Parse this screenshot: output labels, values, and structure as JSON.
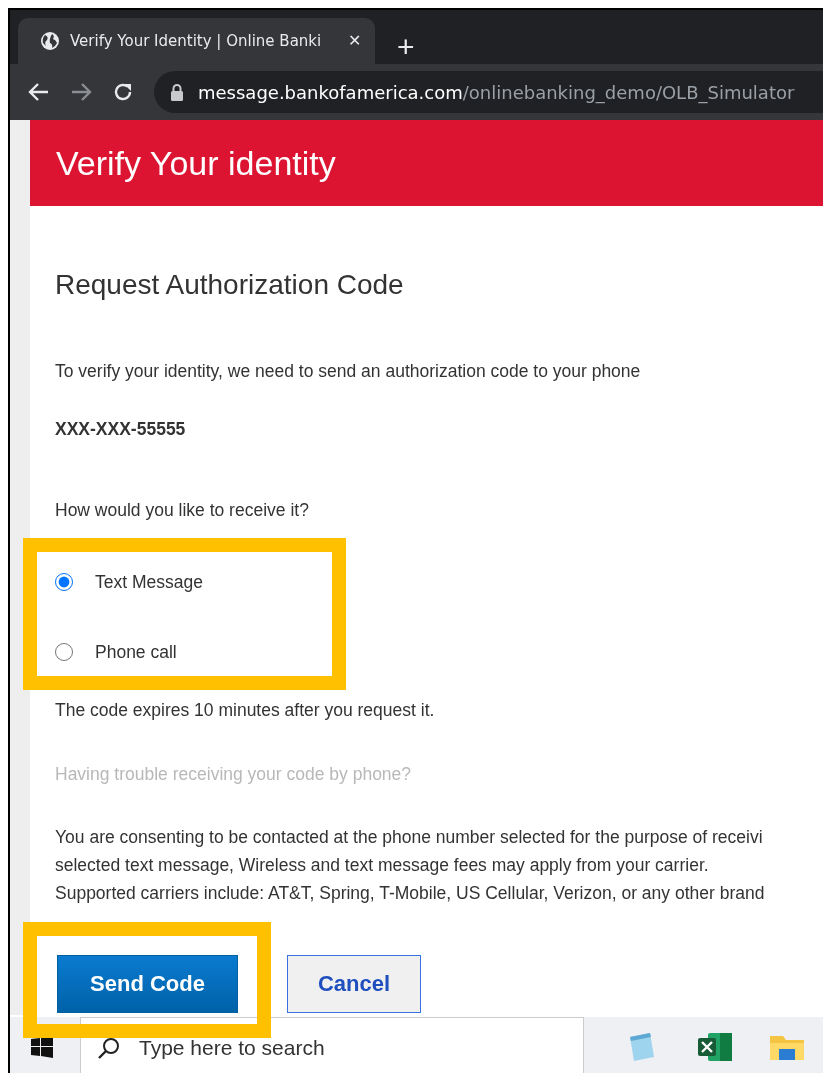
{
  "browser": {
    "tab_title": "Verify Your Identity | Online Banki",
    "close_glyph": "✕",
    "new_tab_glyph": "+",
    "url_host": "message.bankofamerica.com",
    "url_path": "/onlinebanking_demo/OLB_Simulator"
  },
  "header": {
    "title": "Verify Your identity"
  },
  "page": {
    "heading": "Request Authorization Code",
    "intro": "To verify your identity, we need to send an authorization code to your phone",
    "phone": "XXX-XXX-55555",
    "question": "How would you like to receive it?",
    "options": [
      {
        "label": "Text Message",
        "selected": true
      },
      {
        "label": "Phone call",
        "selected": false
      }
    ],
    "expiry": "The code expires 10 minutes after you request it.",
    "help_link": "Having trouble receiving your code by phone?",
    "consent_lines": [
      "You are consenting to be contacted at the phone number selected for the purpose of receivi",
      "selected text message, Wireless and text message fees may apply from your carrier.",
      "Supported carriers include: AT&T, Spring, T-Mobile, US Cellular, Verizon, or any other brand"
    ],
    "buttons": [
      {
        "label": "Send Code",
        "kind": "primary"
      },
      {
        "label": "Cancel",
        "kind": "secondary"
      }
    ]
  },
  "taskbar": {
    "search_placeholder": "Type here to search"
  }
}
